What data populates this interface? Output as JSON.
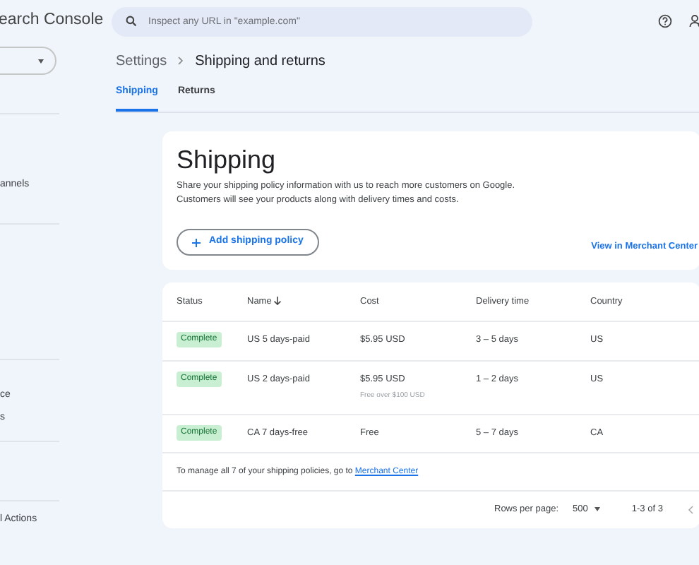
{
  "header": {
    "app_title": "earch Console",
    "search": {
      "placeholder": "Inspect any URL in \"example.com\""
    }
  },
  "sidebar": {
    "items": [
      {
        "label": "annels"
      },
      {
        "label": "ce"
      },
      {
        "label": "s"
      },
      {
        "label": "l Actions"
      }
    ]
  },
  "breadcrumb": [
    "Settings",
    "Shipping and returns"
  ],
  "tabs": [
    {
      "label": "Shipping",
      "selected": true
    },
    {
      "label": "Returns",
      "selected": false
    }
  ],
  "intro_card": {
    "title": "Shipping",
    "description": "Share your shipping policy information with us to reach more customers on Google.\nCustomers will see your products along with delivery times and costs.",
    "add_button": "Add shipping policy",
    "link": "View in Merchant Center"
  },
  "table": {
    "columns": [
      {
        "label": "Status",
        "sorted": false
      },
      {
        "label": "Name",
        "sorted": true
      },
      {
        "label": "Cost",
        "sorted": false
      },
      {
        "label": "Delivery time",
        "sorted": false
      },
      {
        "label": "Country",
        "sorted": false
      }
    ],
    "rows": [
      {
        "status": "Complete",
        "name": "US 5 days-paid",
        "cost": "$5.95 USD",
        "cost_note": "",
        "delivery": "3 – 5 days",
        "country": "US"
      },
      {
        "status": "Complete",
        "name": "US 2 days-paid",
        "cost": "$5.95  USD",
        "cost_note": "Free over $100 USD",
        "delivery": "1 – 2 days",
        "country": "US"
      },
      {
        "status": "Complete",
        "name": "CA 7 days-free",
        "cost": "Free",
        "cost_note": "",
        "delivery": "5 – 7 days",
        "country": "CA"
      }
    ],
    "footer_text": "To manage all 7 of your shipping policies, go to ",
    "footer_link": "Merchant Center",
    "pagination": {
      "rows_label": "Rows per page:",
      "rows_value": "500",
      "range": "1-3 of 3"
    }
  }
}
